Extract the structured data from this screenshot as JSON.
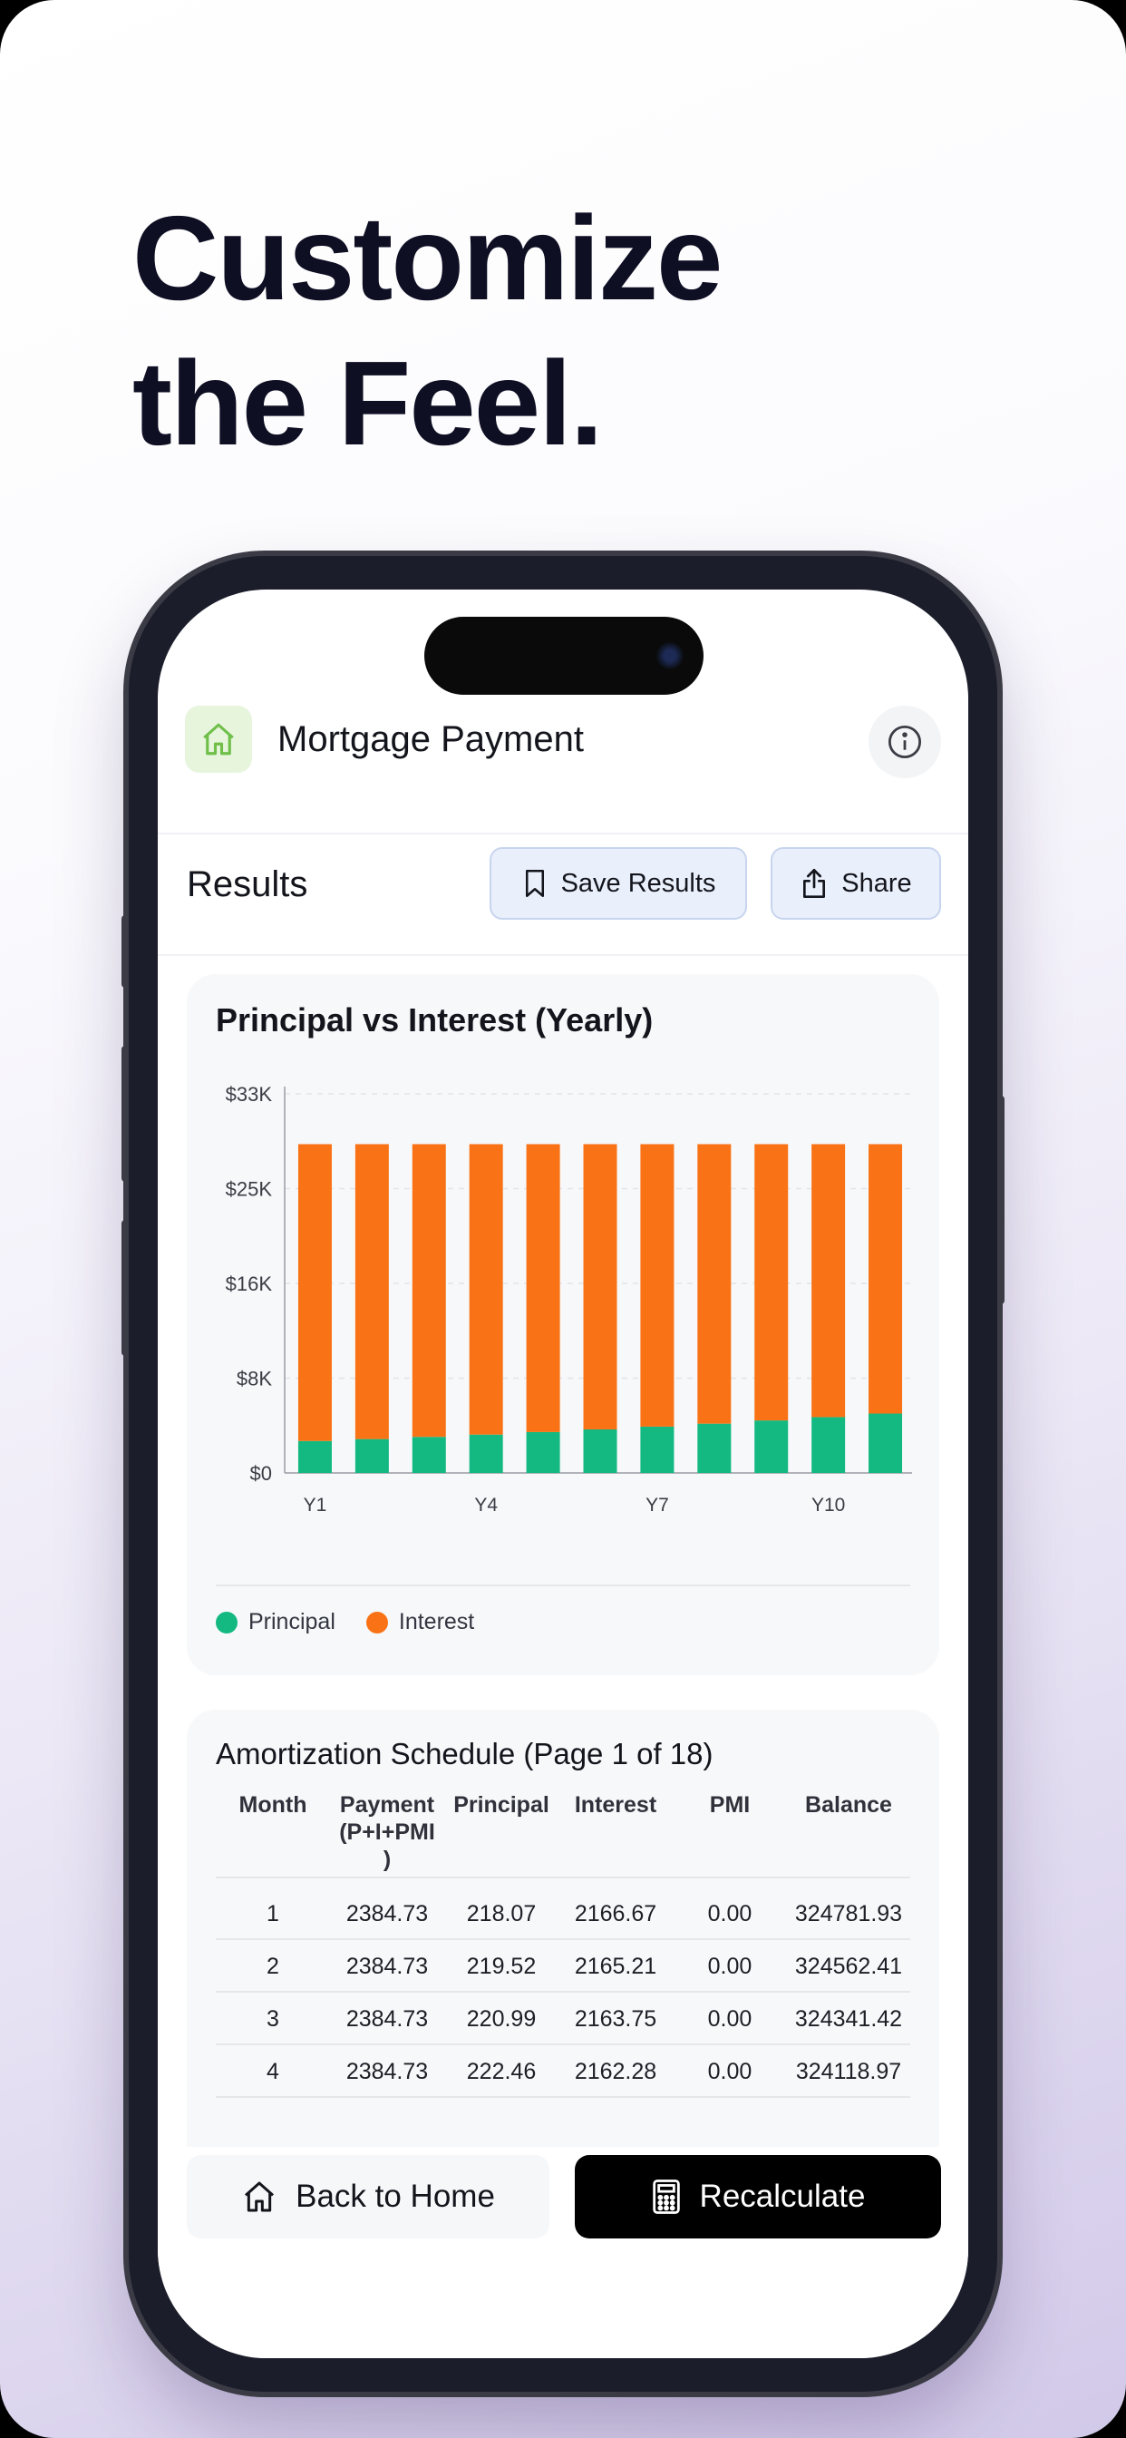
{
  "headline": {
    "line1": "Customize",
    "line2": "the Feel."
  },
  "app": {
    "title": "Mortgage Payment",
    "home_icon": "home-icon",
    "info_icon": "info-icon"
  },
  "results": {
    "label": "Results",
    "save_label": "Save Results",
    "save_icon": "bookmark-icon",
    "share_label": "Share",
    "share_icon": "share-icon"
  },
  "chart_data": {
    "type": "bar",
    "stacked": true,
    "title": "Principal vs Interest (Yearly)",
    "categories": [
      "Y1",
      "Y2",
      "Y3",
      "Y4",
      "Y5",
      "Y6",
      "Y7",
      "Y8",
      "Y9",
      "Y10",
      "Y11"
    ],
    "x_tick_labels": [
      "Y1",
      "",
      "",
      "Y4",
      "",
      "",
      "Y7",
      "",
      "",
      "Y10",
      ""
    ],
    "y_ticks": [
      "$0",
      "$8K",
      "$16K",
      "$25K",
      "$33K"
    ],
    "ylim": [
      0,
      33000
    ],
    "grid": true,
    "legend_position": "bottom-left",
    "series": [
      {
        "name": "Principal",
        "color": "#13b981",
        "values": [
          2780,
          2950,
          3140,
          3340,
          3560,
          3790,
          4030,
          4290,
          4570,
          4860,
          5170
        ]
      },
      {
        "name": "Interest",
        "color": "#f97316",
        "values": [
          25840,
          25670,
          25480,
          25280,
          25060,
          24830,
          24590,
          24330,
          24050,
          23760,
          23450
        ]
      }
    ]
  },
  "legend": {
    "principal": "Principal",
    "interest": "Interest"
  },
  "schedule": {
    "title": "Amortization Schedule (Page 1 of 18)",
    "headers": {
      "month": "Month",
      "payment1": "Payment",
      "payment2": "(P+I+PMI",
      "payment3": ")",
      "principal": "Principal",
      "interest": "Interest",
      "pmi": "PMI",
      "balance": "Balance"
    },
    "rows": [
      {
        "month": "1",
        "payment": "2384.73",
        "principal": "218.07",
        "interest": "2166.67",
        "pmi": "0.00",
        "balance": "324781.93"
      },
      {
        "month": "2",
        "payment": "2384.73",
        "principal": "219.52",
        "interest": "2165.21",
        "pmi": "0.00",
        "balance": "324562.41"
      },
      {
        "month": "3",
        "payment": "2384.73",
        "principal": "220.99",
        "interest": "2163.75",
        "pmi": "0.00",
        "balance": "324341.42"
      },
      {
        "month": "4",
        "payment": "2384.73",
        "principal": "222.46",
        "interest": "2162.28",
        "pmi": "0.00",
        "balance": "324118.97"
      }
    ]
  },
  "bottom": {
    "back_label": "Back to Home",
    "recalc_label": "Recalculate",
    "back_icon": "home-icon",
    "recalc_icon": "calculator-icon"
  }
}
